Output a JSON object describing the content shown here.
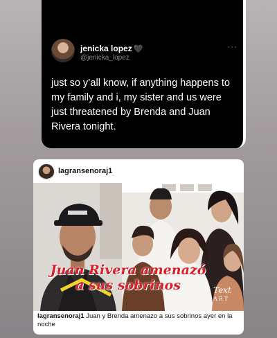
{
  "tweet": {
    "name": "jenicka lopez",
    "verified_icon": "black-heart",
    "handle": "@jenicka_lopez",
    "more": "···",
    "text": "just so y’all know, if anything happens to my family and i, my sister and us were just threatened by Brenda and Juan Rivera tonight."
  },
  "post": {
    "username": "lagransenoraj1",
    "image_overlay_text": "Juan Rivera amenazó a sus sobrinos",
    "watermark_line1": "Text",
    "watermark_line2": "ART",
    "caption_user": "lagransenoraj1",
    "caption_text": " Juan y Brenda amenazo a sus sobrinos ayer en la noche"
  },
  "colors": {
    "overlay_red": "#d8202a",
    "tweet_bg": "#000000"
  }
}
